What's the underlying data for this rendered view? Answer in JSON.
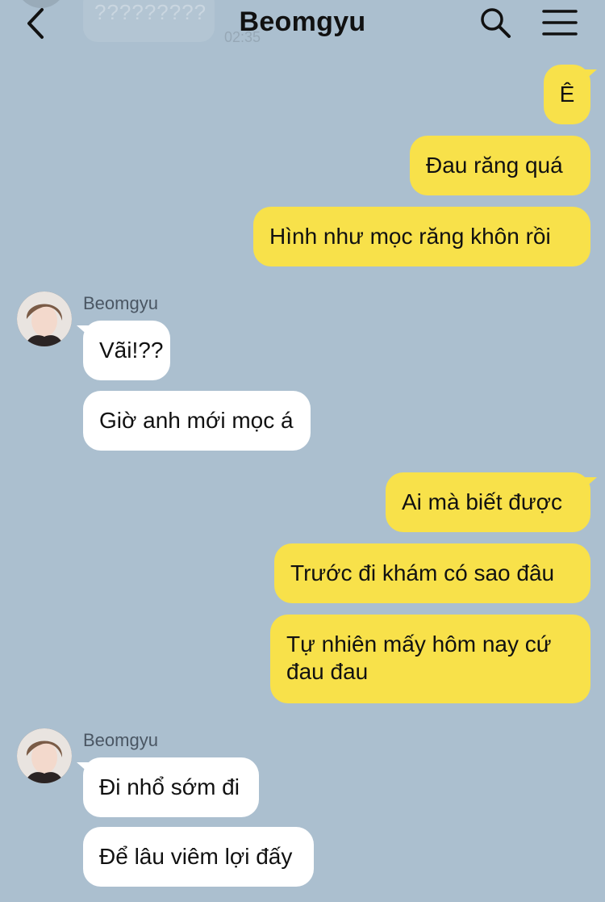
{
  "header": {
    "title": "Beomgyu",
    "back_icon": "chevron-left-icon",
    "search_icon": "search-icon",
    "menu_icon": "menu-icon"
  },
  "ghost_message": {
    "text": "?????????",
    "time": "02:35"
  },
  "messages": [
    {
      "from": "me",
      "text": "Ê"
    },
    {
      "from": "me",
      "text": "Đau răng quá"
    },
    {
      "from": "me",
      "text": "Hình như mọc răng khôn rồi"
    },
    {
      "from": "them",
      "sender": "Beomgyu",
      "text": "Vãi!??"
    },
    {
      "from": "them",
      "text": "Giờ anh mới mọc á"
    },
    {
      "from": "me",
      "text": "Ai mà biết được"
    },
    {
      "from": "me",
      "text": "Trước đi khám có sao đâu"
    },
    {
      "from": "me",
      "text": "Tự nhiên mấy hôm nay cứ đau đau"
    },
    {
      "from": "them",
      "sender": "Beomgyu",
      "text": "Đi nhổ sớm đi"
    },
    {
      "from": "them",
      "text": "Để lâu viêm lợi đấy"
    }
  ],
  "colors": {
    "background": "#abbfcf",
    "my_bubble": "#f8e14a",
    "their_bubble": "#ffffff"
  }
}
